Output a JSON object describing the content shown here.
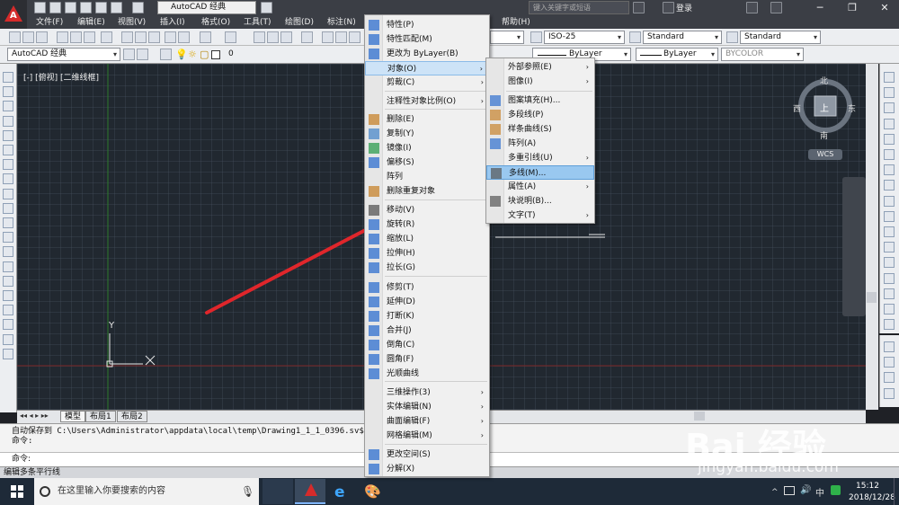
{
  "titlebar": {
    "workspace": "AutoCAD 经典",
    "search_placeholder": "键入关键字或短语",
    "login": "登录"
  },
  "menubar": {
    "items": [
      "文件(F)",
      "编辑(E)",
      "视图(V)",
      "插入(I)",
      "格式(O)",
      "工具(T)",
      "绘图(D)",
      "标注(N)",
      "帮助(H)"
    ]
  },
  "toolbar": {
    "dimstyle": "ISO-25",
    "textstyle": "Standard",
    "tablestyle": "Standard",
    "workspace2": "AutoCAD 经典",
    "layer": "0",
    "color": "ByLayer",
    "linetype": "ByLayer",
    "plotstyle": "BYCOLOR"
  },
  "viewport": {
    "label": "[-] [俯视] [二维线框]",
    "ucs_y": "Y",
    "compass": {
      "n": "北",
      "s": "南",
      "e": "东",
      "w": "西",
      "top": "上"
    },
    "wcs": "WCS"
  },
  "layout_tabs": [
    "模型",
    "布局1",
    "布局2"
  ],
  "command": {
    "history_line": "自动保存到 C:\\Users\\Administrator\\appdata\\local\\temp\\Drawing1_1_1_0396.sv$ ...",
    "history_prompt": "命令:",
    "prompt": "命令:"
  },
  "status": "编辑多条平行线",
  "taskbar": {
    "search": "在这里输入你要搜索的内容",
    "time": "15:12",
    "date": "2018/12/28"
  },
  "modify_menu": {
    "items": [
      {
        "label": "特性(P)"
      },
      {
        "label": "特性匹配(M)"
      },
      {
        "label": "更改为 ByLayer(B)"
      },
      {
        "label": "对象(O)",
        "submenu": true
      },
      {
        "label": "剪裁(C)",
        "submenu": true
      },
      {
        "label": "注释性对象比例(O)",
        "submenu": true
      },
      {
        "label": "删除(E)"
      },
      {
        "label": "复制(Y)"
      },
      {
        "label": "镜像(I)"
      },
      {
        "label": "偏移(S)"
      },
      {
        "label": "阵列"
      },
      {
        "label": "删除重复对象"
      },
      {
        "label": "移动(V)"
      },
      {
        "label": "旋转(R)"
      },
      {
        "label": "缩放(L)"
      },
      {
        "label": "拉伸(H)"
      },
      {
        "label": "拉长(G)"
      },
      {
        "label": "修剪(T)"
      },
      {
        "label": "延伸(D)"
      },
      {
        "label": "打断(K)"
      },
      {
        "label": "合并(J)"
      },
      {
        "label": "倒角(C)"
      },
      {
        "label": "圆角(F)"
      },
      {
        "label": "光顺曲线"
      },
      {
        "label": "三维操作(3)",
        "submenu": true
      },
      {
        "label": "实体编辑(N)",
        "submenu": true
      },
      {
        "label": "曲面编辑(F)",
        "submenu": true
      },
      {
        "label": "网格编辑(M)",
        "submenu": true
      },
      {
        "label": "更改空间(S)"
      },
      {
        "label": "分解(X)"
      }
    ]
  },
  "object_submenu": {
    "items": [
      {
        "label": "外部参照(E)",
        "submenu": true
      },
      {
        "label": "图像(I)",
        "submenu": true
      },
      {
        "label": "图案填充(H)..."
      },
      {
        "label": "多段线(P)"
      },
      {
        "label": "样条曲线(S)"
      },
      {
        "label": "阵列(A)"
      },
      {
        "label": "多重引线(U)",
        "submenu": true
      },
      {
        "label": "多线(M)..."
      },
      {
        "label": "属性(A)",
        "submenu": true
      },
      {
        "label": "块说明(B)..."
      },
      {
        "label": "文字(T)",
        "submenu": true
      }
    ]
  },
  "watermark": {
    "logo": "Bai 经验",
    "url": "jingyan.baidu.com"
  },
  "colors": {
    "accent_red": "#e0262b",
    "highlight": "#99c8f0"
  }
}
